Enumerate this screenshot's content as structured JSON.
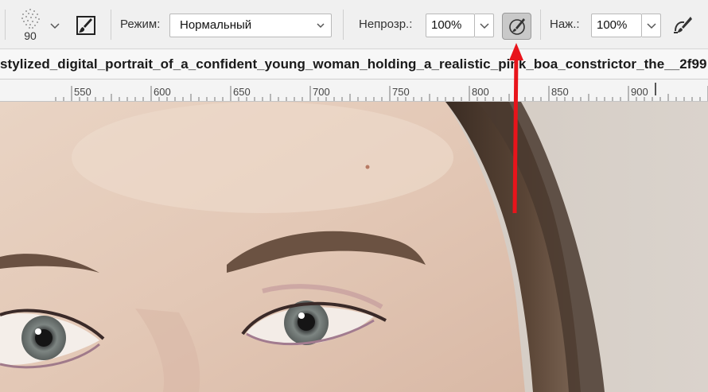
{
  "toolbar": {
    "brush_size": "90",
    "mode_label": "Режим:",
    "mode_value": "Нормальный",
    "opacity_label": "Непрозр.:",
    "opacity_value": "100%",
    "pressure_label": "Наж.:",
    "pressure_value": "100%",
    "icons": [
      "brush-preset-icon",
      "chevron-down-icon",
      "brush-settings-icon",
      "airbrush-icon",
      "pressure-opacity-icon"
    ]
  },
  "document": {
    "title": "stylized_digital_portrait_of_a_confident_young_woman_holding_a_realistic_pink_boa_constrictor_the__2f99"
  },
  "ruler": {
    "labels": [
      "550",
      "600",
      "650",
      "700",
      "750",
      "800",
      "850",
      "900"
    ]
  },
  "annotation": {
    "arrow_color": "#e8141b"
  }
}
